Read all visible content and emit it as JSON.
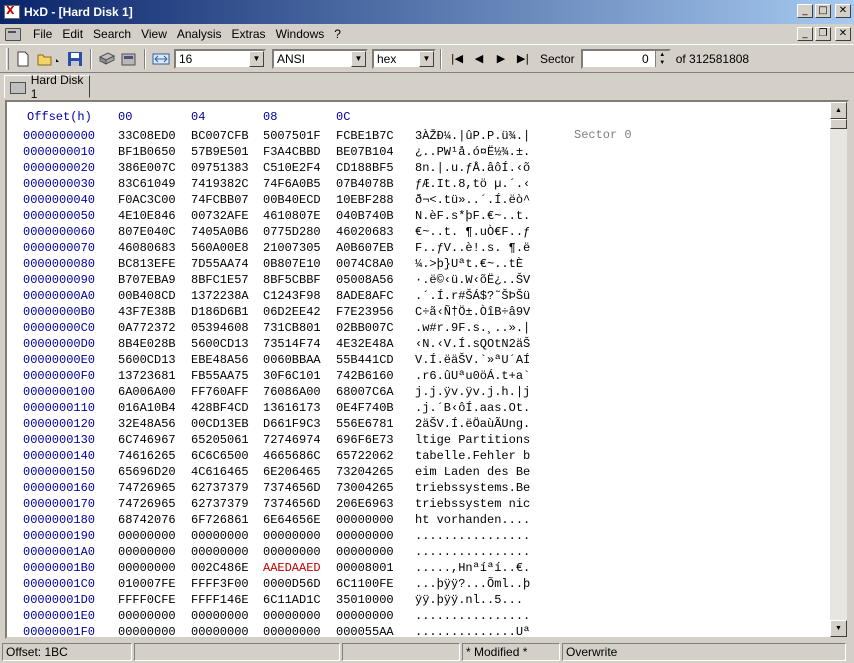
{
  "window": {
    "title": "HxD - [Hard Disk 1]"
  },
  "menu": [
    "File",
    "Edit",
    "Search",
    "View",
    "Analysis",
    "Extras",
    "Windows",
    "?"
  ],
  "toolbar": {
    "columns": "16",
    "charset": "ANSI",
    "offset_base": "hex",
    "sector_label": "Sector",
    "sector_value": "0",
    "sector_total": "of 312581808"
  },
  "tab": {
    "label": "Hard Disk 1"
  },
  "editor": {
    "offset_header": "Offset(h)",
    "col_headers": [
      "00",
      "04",
      "08",
      "0C"
    ],
    "sector_note": "Sector 0",
    "rows": [
      {
        "o": "0000000000",
        "h": [
          "33C08ED0",
          "BC007CFB",
          "5007501F",
          "FCBE1B7C"
        ],
        "t": "3ÀŽÐ¼.|ûP.P.ü¾.|"
      },
      {
        "o": "0000000010",
        "h": [
          "BF1B0650",
          "57B9E501",
          "F3A4CBBD",
          "BE07B104"
        ],
        "t": "¿..PW¹å.ó¤Ë½¾.±."
      },
      {
        "o": "0000000020",
        "h": [
          "386E007C",
          "09751383",
          "C510E2F4",
          "CD188BF5"
        ],
        "t": "8n.|.u.ƒÅ.âôÍ.‹õ"
      },
      {
        "o": "0000000030",
        "h": [
          "83C61049",
          "7419382C",
          "74F6A0B5",
          "07B4078B"
        ],
        "t": "ƒÆ.It.8,tö µ.´.‹"
      },
      {
        "o": "0000000040",
        "h": [
          "F0AC3C00",
          "74FCBB07",
          "00B40ECD",
          "10EBF288"
        ],
        "t": "ð¬<.tü»..´.Í.ëò^"
      },
      {
        "o": "0000000050",
        "h": [
          "4E10E846",
          "00732AFE",
          "4610807E",
          "040B740B"
        ],
        "t": "N.èF.s*þF.€~..t."
      },
      {
        "o": "0000000060",
        "h": [
          "807E040C",
          "7405A0B6",
          "0775D280",
          "46020683"
        ],
        "t": "€~..t. ¶.uÒ€F..ƒ"
      },
      {
        "o": "0000000070",
        "h": [
          "46080683",
          "560A00E8",
          "21007305",
          "A0B607EB"
        ],
        "t": "F..ƒV..è!.s. ¶.ë"
      },
      {
        "o": "0000000080",
        "h": [
          "BC813EFE",
          "7D55AA74",
          "0B807E10",
          "0074C8A0"
        ],
        "t": "¼.>þ}Uªt.€~..tÈ "
      },
      {
        "o": "0000000090",
        "h": [
          "B707EBA9",
          "8BFC1E57",
          "8BF5CBBF",
          "05008A56"
        ],
        "t": "·.ë©‹ü.W‹õË¿..ŠV"
      },
      {
        "o": "00000000A0",
        "h": [
          "00B408CD",
          "1372238A",
          "C1243F98",
          "8ADE8AFC"
        ],
        "t": ".´.Í.r#ŠÁ$?˜ŠÞŠü"
      },
      {
        "o": "00000000B0",
        "h": [
          "43F7E38B",
          "D186D6B1",
          "06D2EE42",
          "F7E23956"
        ],
        "t": "C÷ã‹Ñ†Ö±.ÒîB÷â9V"
      },
      {
        "o": "00000000C0",
        "h": [
          "0A772372",
          "05394608",
          "731CB801",
          "02BB007C"
        ],
        "t": ".w#r.9F.s.¸..».|"
      },
      {
        "o": "00000000D0",
        "h": [
          "8B4E028B",
          "5600CD13",
          "73514F74",
          "4E32E48A"
        ],
        "t": "‹N.‹V.Í.sQOtN2äŠ"
      },
      {
        "o": "00000000E0",
        "h": [
          "5600CD13",
          "EBE48A56",
          "0060BBAA",
          "55B441CD"
        ],
        "t": "V.Í.ëäŠV.`»ªU´AÍ"
      },
      {
        "o": "00000000F0",
        "h": [
          "13723681",
          "FB55AA75",
          "30F6C101",
          "742B6160"
        ],
        "t": ".r6.ûUªu0öÁ.t+a`"
      },
      {
        "o": "0000000100",
        "h": [
          "6A006A00",
          "FF760AFF",
          "76086A00",
          "68007C6A"
        ],
        "t": "j.j.ÿv.ÿv.j.h.|j"
      },
      {
        "o": "0000000110",
        "h": [
          "016A10B4",
          "428BF4CD",
          "13616173",
          "0E4F740B"
        ],
        "t": ".j.´B‹ôÍ.aas.Ot."
      },
      {
        "o": "0000000120",
        "h": [
          "32E48A56",
          "00CD13EB",
          "D661F9C3",
          "556E6781"
        ],
        "t": "2äŠV.Í.ëÖaùÃUng."
      },
      {
        "o": "0000000130",
        "h": [
          "6C746967",
          "65205061",
          "72746974",
          "696F6E73"
        ],
        "t": "ltige Partitions"
      },
      {
        "o": "0000000140",
        "h": [
          "74616265",
          "6C6C6500",
          "4665686C",
          "65722062"
        ],
        "t": "tabelle.Fehler b"
      },
      {
        "o": "0000000150",
        "h": [
          "65696D20",
          "4C616465",
          "6E206465",
          "73204265"
        ],
        "t": "eim Laden des Be"
      },
      {
        "o": "0000000160",
        "h": [
          "74726965",
          "62737379",
          "7374656D",
          "73004265"
        ],
        "t": "triebssystems.Be"
      },
      {
        "o": "0000000170",
        "h": [
          "74726965",
          "62737379",
          "7374656D",
          "206E6963"
        ],
        "t": "triebssystem nic"
      },
      {
        "o": "0000000180",
        "h": [
          "68742076",
          "6F726861",
          "6E64656E",
          "00000000"
        ],
        "t": "ht vorhanden...."
      },
      {
        "o": "0000000190",
        "h": [
          "00000000",
          "00000000",
          "00000000",
          "00000000"
        ],
        "t": "................"
      },
      {
        "o": "00000001A0",
        "h": [
          "00000000",
          "00000000",
          "00000000",
          "00000000"
        ],
        "t": "................"
      },
      {
        "o": "00000001B0",
        "h": [
          "00000000",
          "002C486E",
          "AAEDAAED",
          "00008001"
        ],
        "t": ".....,Hnªíªí..€.",
        "hl": 2
      },
      {
        "o": "00000001C0",
        "h": [
          "010007FE",
          "FFFF3F00",
          "0000D56D",
          "6C1100FE"
        ],
        "t": "...þÿÿ?...Õml..þ"
      },
      {
        "o": "00000001D0",
        "h": [
          "FFFF0CFE",
          "FFFF146E",
          "6C11AD1C",
          "35010000"
        ],
        "t": "ÿÿ.þÿÿ.nl.­.5..."
      },
      {
        "o": "00000001E0",
        "h": [
          "00000000",
          "00000000",
          "00000000",
          "00000000"
        ],
        "t": "................"
      },
      {
        "o": "00000001F0",
        "h": [
          "00000000",
          "00000000",
          "00000000",
          "000055AA"
        ],
        "t": "..............Uª"
      }
    ]
  },
  "status": {
    "offset": "Offset: 1BC",
    "modified": "* Modified *",
    "mode": "Overwrite"
  }
}
